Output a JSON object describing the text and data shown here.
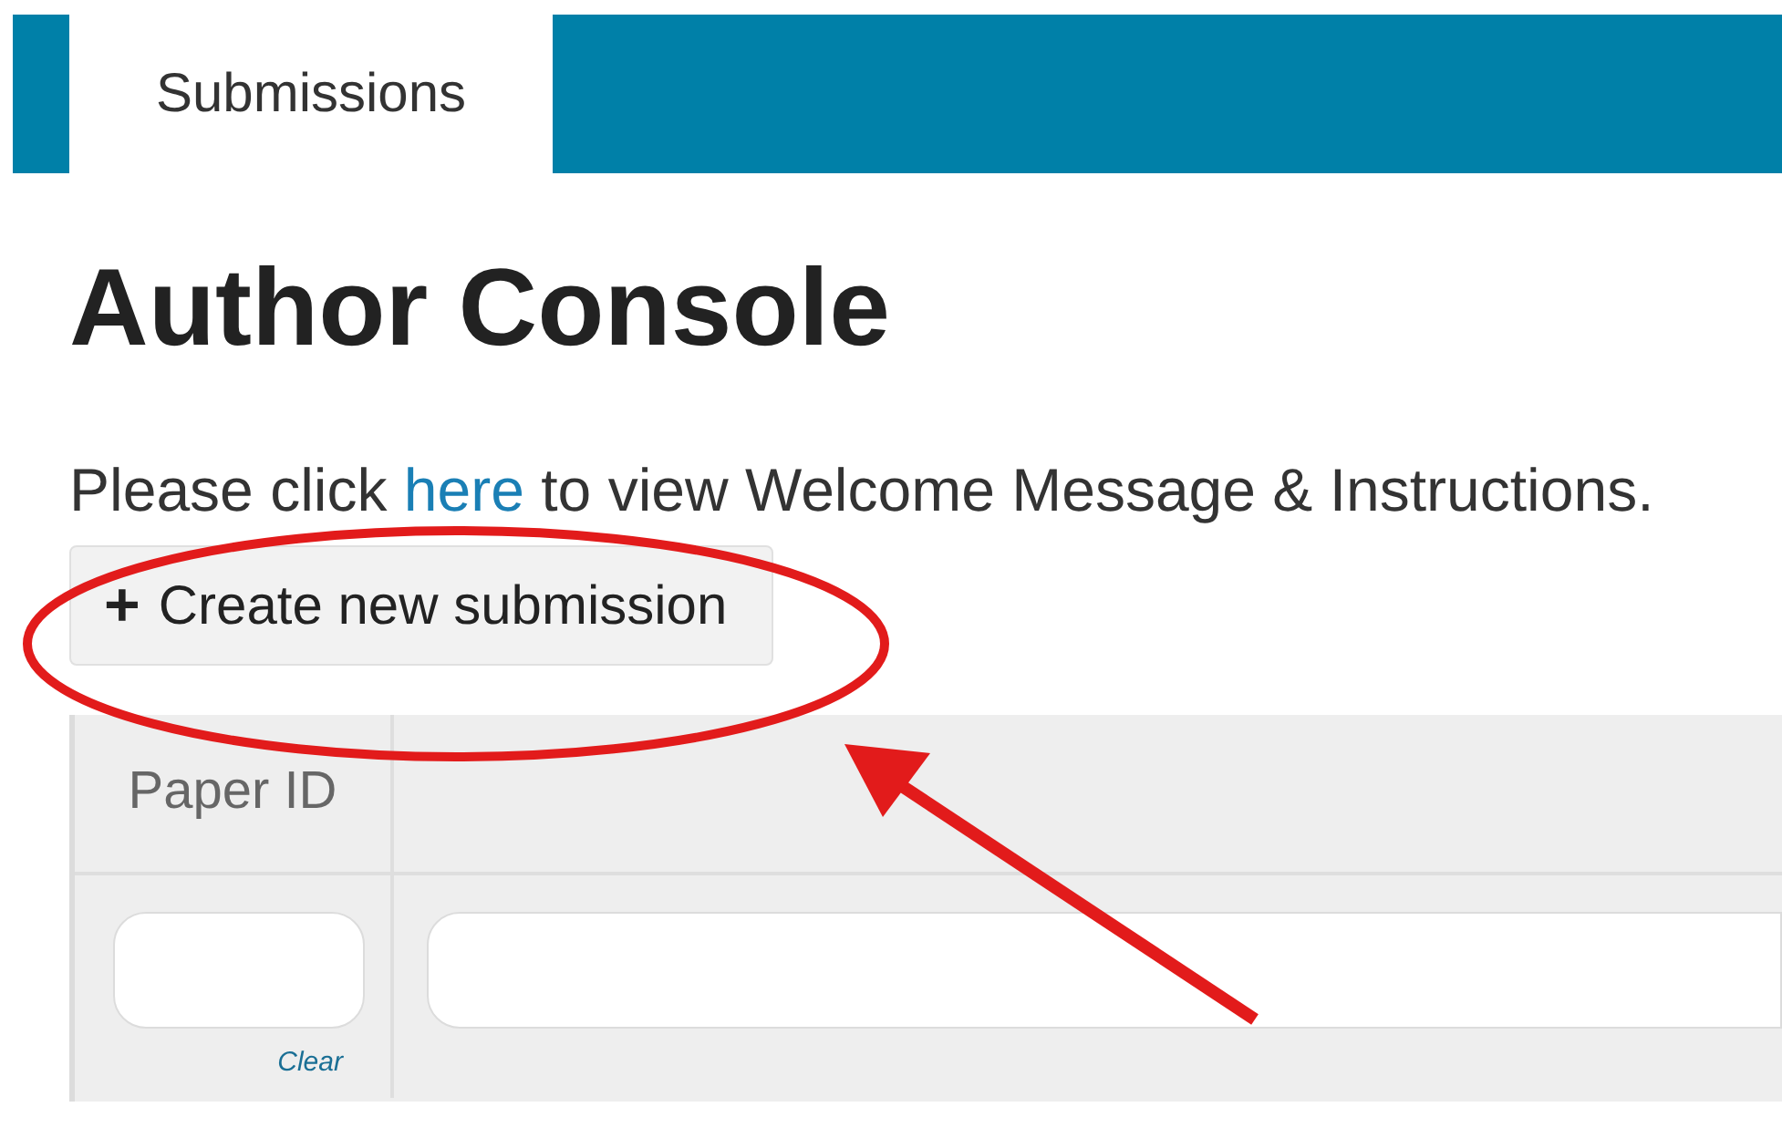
{
  "tabs": [
    {
      "label": "Submissions",
      "selected": true
    }
  ],
  "heading": "Author Console",
  "intro": {
    "before": "Please click ",
    "link": "here",
    "after": " to view Welcome Message & Instructions."
  },
  "create_button": {
    "icon": "+",
    "label": "Create new submission"
  },
  "table": {
    "columns": [
      {
        "heading": "Paper ID",
        "clear_link": "Clear"
      }
    ]
  },
  "annotation": {
    "highlight_ellipse": true,
    "pointer_arrow": true
  }
}
